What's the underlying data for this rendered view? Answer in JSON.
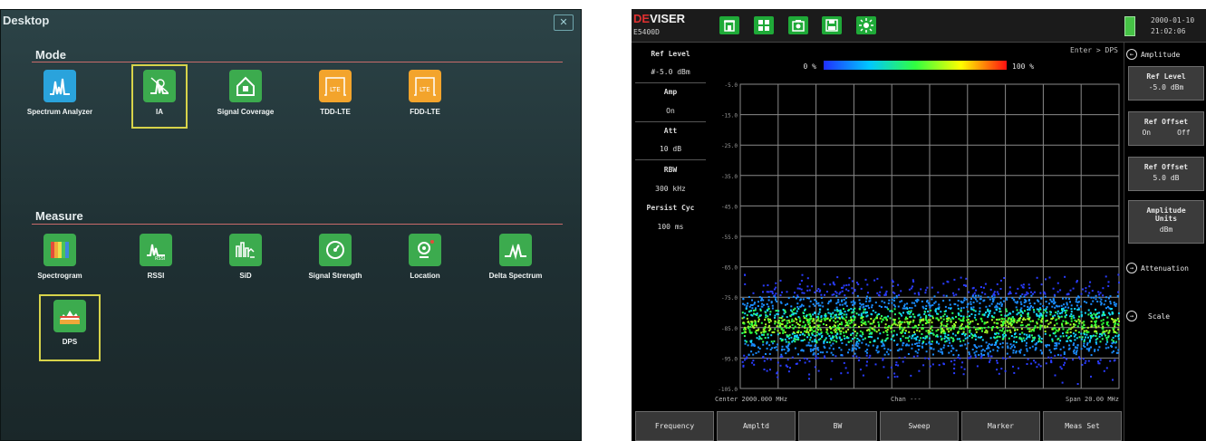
{
  "desktop": {
    "title": "Desktop",
    "close_glyph": "✕",
    "mode": {
      "title": "Mode",
      "apps": [
        {
          "label": "Spectrum Analyzer",
          "icon": "spectrum-analyzer-icon"
        },
        {
          "label": "IA",
          "icon": "ia-icon",
          "selected": true
        },
        {
          "label": "Signal Coverage",
          "icon": "signal-coverage-icon"
        },
        {
          "label": "TDD-LTE",
          "icon": "tdd-lte-icon",
          "badge": "LTE"
        },
        {
          "label": "FDD-LTE",
          "icon": "fdd-lte-icon",
          "badge": "LTE"
        }
      ]
    },
    "measure": {
      "title": "Measure",
      "apps": [
        {
          "label": "Spectrogram",
          "icon": "spectrogram-icon"
        },
        {
          "label": "RSSI",
          "icon": "rssi-icon"
        },
        {
          "label": "SiD",
          "icon": "sid-icon"
        },
        {
          "label": "Signal Strength",
          "icon": "signal-strength-icon"
        },
        {
          "label": "Location",
          "icon": "location-icon"
        },
        {
          "label": "Delta Spectrum",
          "icon": "delta-spectrum-icon"
        },
        {
          "label": "DPS",
          "icon": "dps-icon",
          "selected": true
        }
      ]
    }
  },
  "analyzer": {
    "brand_a": "DE",
    "brand_b": "VISER",
    "model": "E5400D",
    "datetime_date": "2000-01-10",
    "datetime_time": "21:02:06",
    "info": {
      "ref_level_label": "Ref Level",
      "ref_level_value": "#-5.0 dBm",
      "amp_label": "Amp",
      "amp_value": "On",
      "att_label": "Att",
      "att_value": "10 dB",
      "rbw_label": "RBW",
      "rbw_value": "300 kHz",
      "persist_label": "Persist Cyc",
      "persist_value": "100 ms"
    },
    "plot": {
      "breadcrumb": "Enter > DPS",
      "scale_min": "0 %",
      "scale_max": "100 %",
      "y_ticks": [
        "-5.0",
        "-15.0",
        "-25.0",
        "-35.0",
        "-45.0",
        "-55.0",
        "-65.0",
        "-75.0",
        "-85.0",
        "-95.0",
        "-105.0"
      ],
      "center": "Center 2000.000 MHz",
      "chan": "Chan ---",
      "span": "Span 20.00 MHz"
    },
    "softkeys_right": {
      "title": "Amplitude",
      "ref_level_label": "Ref Level",
      "ref_level_value": "-5.0 dBm",
      "ref_offset_label": "Ref Offset",
      "ref_offset_on": "On",
      "ref_offset_off": "Off",
      "ref_offset2_label": "Ref Offset",
      "ref_offset2_value": "5.0 dB",
      "amp_units_label": "Amplitude Units",
      "amp_units_value": "dBm",
      "attenuation": "Attenuation",
      "scale": "Scale"
    },
    "softkeys_bottom": [
      "Frequency",
      "Ampltd",
      "BW",
      "Sweep",
      "Marker",
      "Meas Set"
    ]
  }
}
